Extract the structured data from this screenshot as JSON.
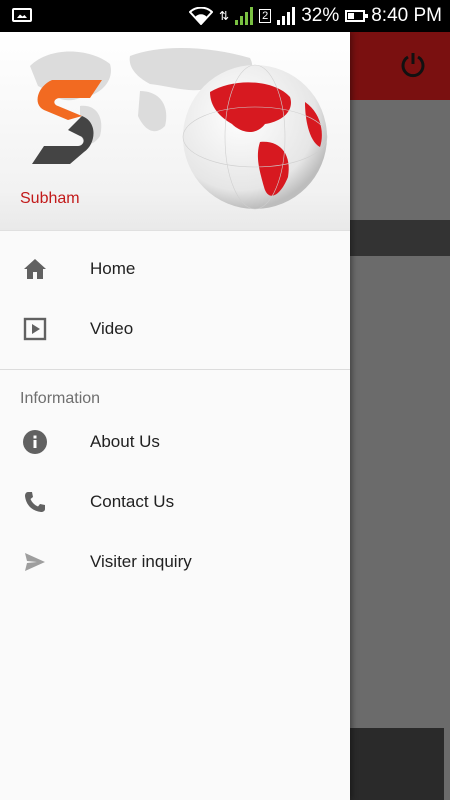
{
  "status_bar": {
    "battery": "32%",
    "time": "8:40 PM",
    "sim_label": "2"
  },
  "drawer": {
    "user_name": "Subham",
    "primary_items": [
      {
        "label": "Home",
        "icon": "home-icon"
      },
      {
        "label": "Video",
        "icon": "video-icon"
      }
    ],
    "section_title": "Information",
    "info_items": [
      {
        "label": "About Us",
        "icon": "info-icon"
      },
      {
        "label": "Contact Us",
        "icon": "phone-icon"
      },
      {
        "label": "Visiter inquiry",
        "icon": "send-icon"
      }
    ]
  },
  "colors": {
    "accent": "#c21a1a",
    "toolbar": "#7a1010",
    "logo_orange": "#f26a21",
    "logo_dark": "#444444"
  }
}
